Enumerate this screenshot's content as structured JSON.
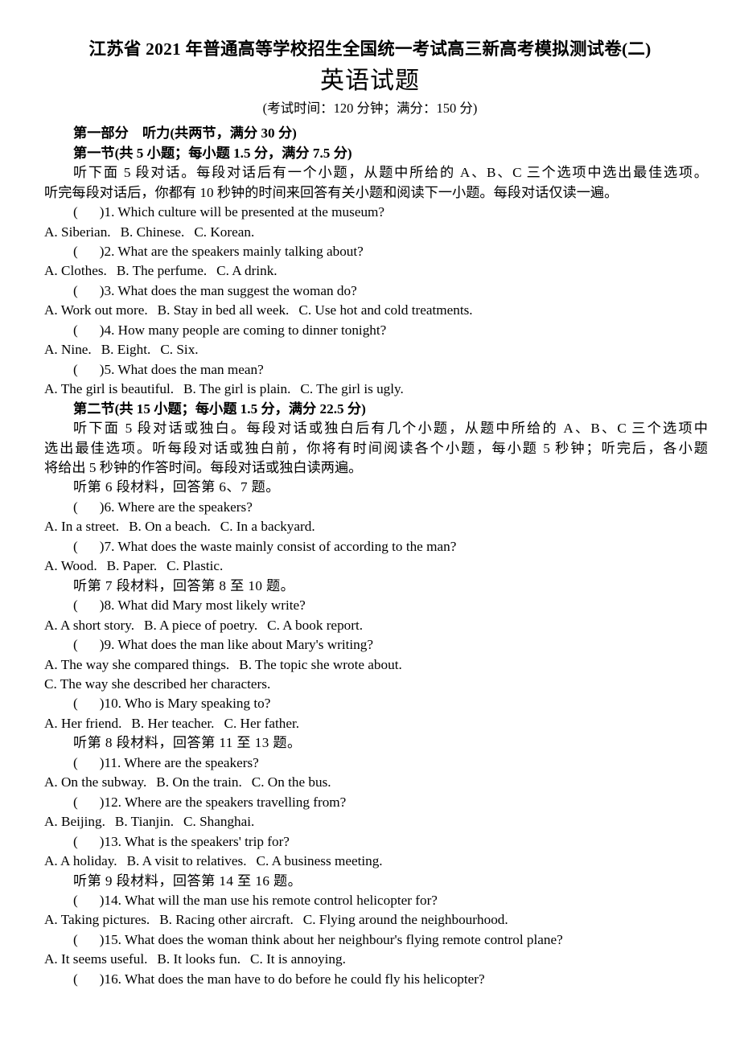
{
  "document": {
    "title": "江苏省 2021 年普通高等学校招生全国统一考试高三新高考模拟测试卷(二)",
    "subject": "英语试题",
    "exam_info": "(考试时间：120 分钟；满分：150 分)"
  },
  "part_one": {
    "heading": "第一部分　听力(共两节，满分 30 分)",
    "section_one": {
      "heading": "第一节(共 5 小题；每小题 1.5 分，满分 7.5 分)",
      "instruction_lines": [
        "听下面 5 段对话。每段对话后有一个小题，从题中所给的 A、B、C 三个选项中选出最佳选项。",
        "听完每段对话后，你都有 10 秒钟的时间来回答有关小题和阅读下一小题。每段对话仅读一遍。"
      ],
      "questions": [
        {
          "number": "1",
          "stem": "Which culture will be presented at the museum?",
          "options": [
            "A. Siberian.",
            "B. Chinese.",
            "C. Korean."
          ]
        },
        {
          "number": "2",
          "stem": "What are the speakers mainly talking about?",
          "options": [
            "A. Clothes.",
            "B. The perfume.",
            "C. A drink."
          ]
        },
        {
          "number": "3",
          "stem": "What does the man suggest the woman do?",
          "options": [
            "A. Work out more.",
            "B. Stay in bed all week.",
            "C. Use hot and cold treatments."
          ]
        },
        {
          "number": "4",
          "stem": "How many people are coming to dinner tonight?",
          "options": [
            "A. Nine.",
            "B. Eight.",
            "C. Six."
          ]
        },
        {
          "number": "5",
          "stem": "What does the man mean?",
          "options": [
            "A. The girl is beautiful.",
            "B. The girl is plain.",
            "C. The girl is ugly."
          ]
        }
      ]
    },
    "section_two": {
      "heading": "第二节(共 15 小题；每小题 1.5 分，满分 22.5 分)",
      "instruction_lines": [
        "听下面 5 段对话或独白。每段对话或独白后有几个小题，从题中所给的 A、B、C 三个选项中",
        "选出最佳选项。听每段对话或独白前，你将有时间阅读各个小题，每小题 5 秒钟；听完后，各小题",
        "将给出 5 秒钟的作答时间。每段对话或独白读两遍。"
      ],
      "material_6": "听第 6 段材料，回答第 6、7 题。",
      "questions_6_7": [
        {
          "number": "6",
          "stem": "Where are the speakers?",
          "options": [
            "A. In a street.",
            "B. On a beach.",
            "C. In a backyard."
          ]
        },
        {
          "number": "7",
          "stem": "What does the waste mainly consist of according to the man?",
          "options": [
            "A. Wood.",
            "B. Paper.",
            "C. Plastic."
          ]
        }
      ],
      "material_7": "听第 7 段材料，回答第 8 至 10 题。",
      "questions_8_10": [
        {
          "number": "8",
          "stem": "What did Mary most likely write?",
          "options": [
            "A. A short story.",
            "B. A piece of poetry.",
            "C. A book report."
          ]
        },
        {
          "number": "9",
          "stem": "What does the man like about Mary's writing?",
          "options": [
            "A. The way she compared things.",
            "B. The topic she wrote about."
          ],
          "options_wrapped": [
            "C. The way she described her characters."
          ]
        },
        {
          "number": "10",
          "stem": "Who is Mary speaking to?",
          "options": [
            "A. Her friend.",
            "B. Her teacher.",
            "C. Her father."
          ]
        }
      ],
      "material_8": "听第 8 段材料，回答第 11 至 13 题。",
      "questions_11_13": [
        {
          "number": "11",
          "stem": "Where are the speakers?",
          "options": [
            "A. On the subway.",
            "B. On the train.",
            "C. On the bus."
          ]
        },
        {
          "number": "12",
          "stem": "Where are the speakers travelling from?",
          "options": [
            "A. Beijing.",
            "B. Tianjin.",
            "C. Shanghai."
          ]
        },
        {
          "number": "13",
          "stem": "What is the speakers' trip for?",
          "options": [
            "A. A holiday.",
            "B. A visit to relatives.",
            "C. A business meeting."
          ]
        }
      ],
      "material_9": "听第 9 段材料，回答第 14 至 16 题。",
      "questions_14_16": [
        {
          "number": "14",
          "stem": "What will the man use his remote control helicopter for?",
          "options": [
            "A. Taking pictures.",
            "B. Racing other aircraft.",
            "C. Flying around the neighbourhood."
          ]
        },
        {
          "number": "15",
          "stem": "What does the woman think about her neighbour's flying remote control plane?",
          "options": [
            "A. It seems useful.",
            "B. It looks fun.",
            "C. It is annoying."
          ]
        },
        {
          "number": "16",
          "stem": "What does the man have to do before he could fly his helicopter?",
          "options": []
        }
      ]
    }
  }
}
